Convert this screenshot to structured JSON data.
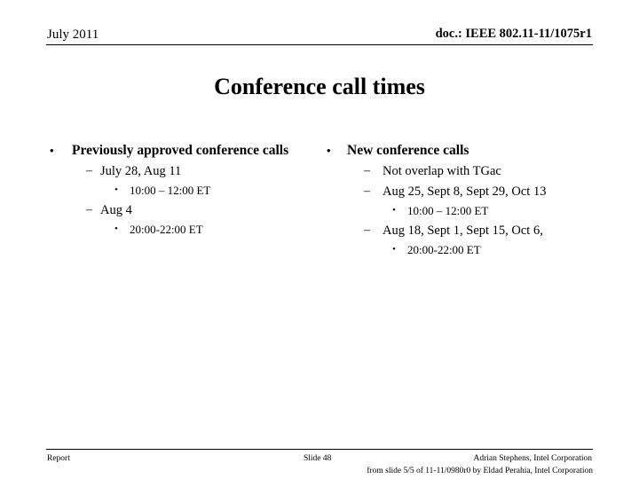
{
  "header": {
    "date": "July 2011",
    "doc_ref": "doc.: IEEE 802.11-11/1075r1"
  },
  "title": "Conference call times",
  "content": {
    "left_column": {
      "heading": "Previously approved conference calls",
      "items": [
        {
          "dates": "July 28, Aug 11",
          "time": "10:00 – 12:00 ET"
        },
        {
          "dates": "Aug 4",
          "time": "20:00-22:00 ET"
        }
      ]
    },
    "right_column": {
      "heading": "New conference calls",
      "constraint": "Not overlap with TGac",
      "items": [
        {
          "dates": "Aug 25, Sept 8, Sept 29, Oct 13",
          "time": "10:00 – 12:00 ET"
        },
        {
          "dates": "Aug 18, Sept 1, Sept 15, Oct 6,",
          "time": "20:00-22:00 ET"
        }
      ]
    }
  },
  "markers": {
    "bullet": "•",
    "dash": "–"
  },
  "footer": {
    "left": "Report",
    "center": "Slide 48",
    "right": "Adrian Stephens, Intel Corporation",
    "source": "from slide 5/5 of 11-11/0980r0 by Eldad Perahia, Intel Corporation"
  }
}
